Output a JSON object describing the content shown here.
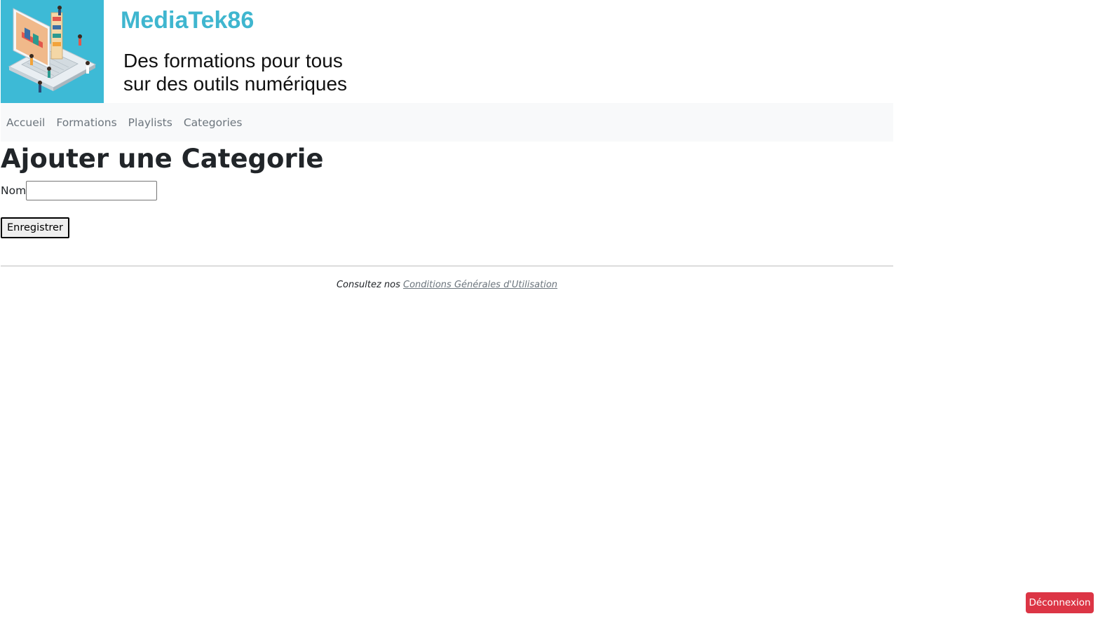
{
  "header": {
    "brand": "MediaTek86",
    "tagline_line1": "Des formations pour tous",
    "tagline_line2": "sur des outils numériques",
    "logo_color": "#3dbad6",
    "brand_color": "#3fb6cf"
  },
  "nav": {
    "items": [
      {
        "label": "Accueil"
      },
      {
        "label": "Formations"
      },
      {
        "label": "Playlists"
      },
      {
        "label": "Categories"
      }
    ]
  },
  "main": {
    "title": "Ajouter une Categorie",
    "form": {
      "name_label": "Nom",
      "name_value": "",
      "submit_label": "Enregistrer"
    }
  },
  "footer": {
    "prefix": "Consultez nos ",
    "link_label": "Conditions Générales d'Utilisation"
  },
  "logout": {
    "label": "Déconnexion",
    "color": "#dc3545"
  }
}
